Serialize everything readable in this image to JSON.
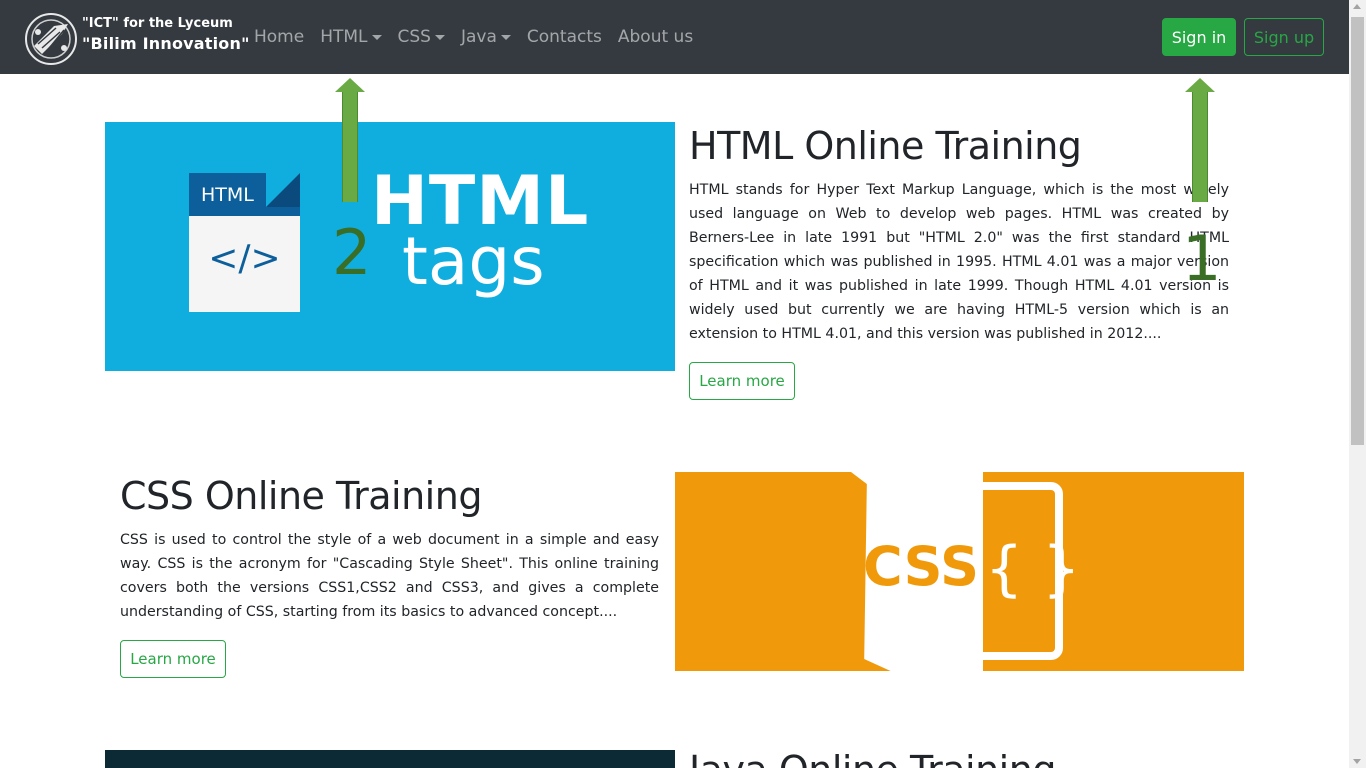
{
  "brand": {
    "line1": "\"ICT\" for the Lyceum",
    "line2": "\"Bilim Innovation\""
  },
  "nav": [
    {
      "label": "Home",
      "dropdown": false
    },
    {
      "label": "HTML",
      "dropdown": true
    },
    {
      "label": "CSS",
      "dropdown": true
    },
    {
      "label": "Java",
      "dropdown": true
    },
    {
      "label": "Contacts",
      "dropdown": false
    },
    {
      "label": "About us",
      "dropdown": false
    }
  ],
  "auth": {
    "signin": "Sign in",
    "signup": "Sign up"
  },
  "colors": {
    "navbar": "#343a40",
    "success": "#28a745",
    "html_bg": "#10aedf",
    "css_bg": "#f09a0b"
  },
  "sections": {
    "html": {
      "title": "HTML Online Training",
      "text": "HTML stands for Hyper Text Markup Language, which is the most widely used language on Web to develop web pages. HTML was created by Berners-Lee in late 1991 but \"HTML 2.0\" was the first standard HTML specification which was published in 1995. HTML 4.01 was a major version of HTML and it was published in late 1999. Though HTML 4.01 version is widely used but currently we are having HTML-5 version which is an extension to HTML 4.01, and this version was published in 2012....",
      "button": "Learn more",
      "image": {
        "doc_label": "HTML",
        "code": "</>",
        "big": "HTML",
        "sub": "tags"
      }
    },
    "css": {
      "title": "CSS Online Training",
      "text": "CSS is used to control the style of a web document in a simple and easy way. CSS is the acronym for \"Cascading Style Sheet\". This online training covers both the versions CSS1,CSS2 and CSS3, and gives a complete understanding of CSS, starting from its basics to advanced concept....",
      "button": "Learn more",
      "image": {
        "text": "CSS",
        "braces": "{ }"
      }
    },
    "java": {
      "title": "Java Online Training"
    }
  },
  "annotations": {
    "arrow1": "1",
    "arrow2": "2"
  }
}
